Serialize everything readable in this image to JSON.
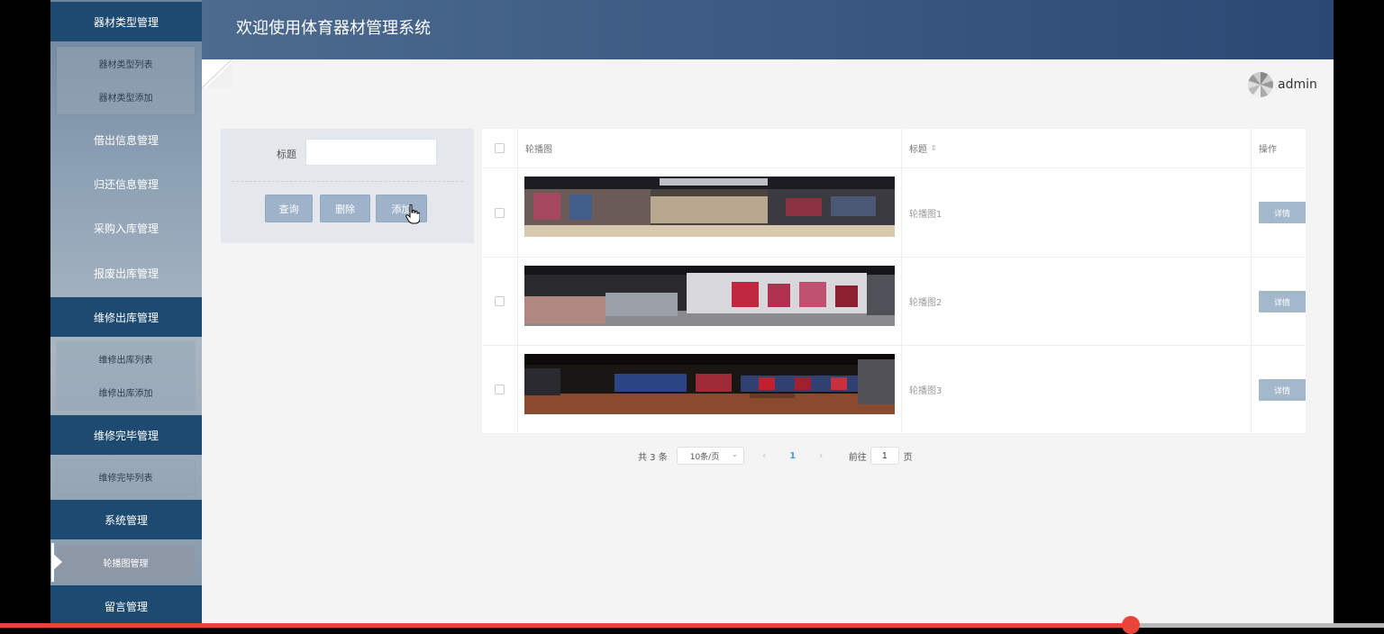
{
  "header": {
    "title": "欢迎使用体育器材管理系统"
  },
  "user": {
    "name": "admin"
  },
  "sidebar": {
    "groups": [
      {
        "label": "器材类型管理",
        "items": [
          "器材类型列表",
          "器材类型添加"
        ]
      },
      {
        "label": "借出信息管理"
      },
      {
        "label": "归还信息管理"
      },
      {
        "label": "采购入库管理"
      },
      {
        "label": "报废出库管理"
      },
      {
        "label": "维修出库管理",
        "items": [
          "维修出库列表",
          "维修出库添加"
        ]
      },
      {
        "label": "维修完毕管理",
        "items": [
          "维修完毕列表"
        ]
      },
      {
        "label": "系统管理",
        "items": [
          "轮播图管理"
        ]
      },
      {
        "label": "留言管理"
      }
    ],
    "active_item": "轮播图管理"
  },
  "search": {
    "label": "标题",
    "value": "",
    "placeholder": "",
    "buttons": {
      "query": "查询",
      "delete": "删除",
      "add": "添加"
    }
  },
  "table": {
    "columns": {
      "image": "轮播图",
      "title": "标题",
      "actions": "操作"
    },
    "rows": [
      {
        "title": "轮播图1",
        "action": "详情"
      },
      {
        "title": "轮播图2",
        "action": "详情"
      },
      {
        "title": "轮播图3",
        "action": "详情"
      }
    ]
  },
  "pagination": {
    "total": "共 3 条",
    "page_size": "10条/页",
    "current_page": "1",
    "goto_label": "前往",
    "goto_value": "1",
    "goto_suffix": "页",
    "prev": "‹",
    "next": "›"
  },
  "video_progress": 0.817,
  "colors": {
    "accent": "#1d4a70",
    "header": "#3f5d84",
    "button": "#9eb3c9",
    "progress": "#e8443a"
  }
}
